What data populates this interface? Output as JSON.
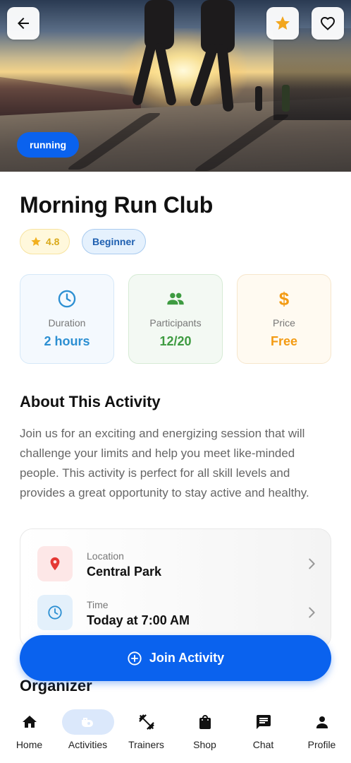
{
  "hero": {
    "tag": "running",
    "back_icon": "arrow-left-icon",
    "star_icon": "star-icon",
    "favorite_icon": "heart-icon"
  },
  "activity": {
    "title": "Morning Run Club",
    "rating": "4.8",
    "level": "Beginner"
  },
  "stats": [
    {
      "icon": "clock-icon",
      "label": "Duration",
      "value": "2 hours",
      "color": "#2c8fd2"
    },
    {
      "icon": "people-icon",
      "label": "Participants",
      "value": "12/20",
      "color": "#3e9b41"
    },
    {
      "icon": "dollar-icon",
      "label": "Price",
      "value": "Free",
      "color": "#f39b14"
    }
  ],
  "about": {
    "heading": "About This Activity",
    "text": "Join us for an exciting and energizing session that will challenge your limits and help you meet like-minded people. This activity is perfect for all skill levels and provides a great opportunity to stay active and healthy."
  },
  "details": [
    {
      "icon": "location-pin-icon",
      "caption": "Location",
      "value": "Central Park"
    },
    {
      "icon": "clock-icon",
      "caption": "Time",
      "value": "Today at 7:00 AM"
    }
  ],
  "join_label": "Join Activity",
  "organizer_heading": "Organizer",
  "nav": {
    "items": [
      {
        "label": "Home",
        "icon": "home-icon",
        "active": false
      },
      {
        "label": "Activities",
        "icon": "activities-icon",
        "active": true
      },
      {
        "label": "Trainers",
        "icon": "dumbbell-icon",
        "active": false
      },
      {
        "label": "Shop",
        "icon": "shopping-bag-icon",
        "active": false
      },
      {
        "label": "Chat",
        "icon": "chat-icon",
        "active": false
      },
      {
        "label": "Profile",
        "icon": "person-icon",
        "active": false
      }
    ]
  },
  "colors": {
    "primary": "#0a62ee",
    "rating": "#f2b01e",
    "location": "#e53935"
  }
}
